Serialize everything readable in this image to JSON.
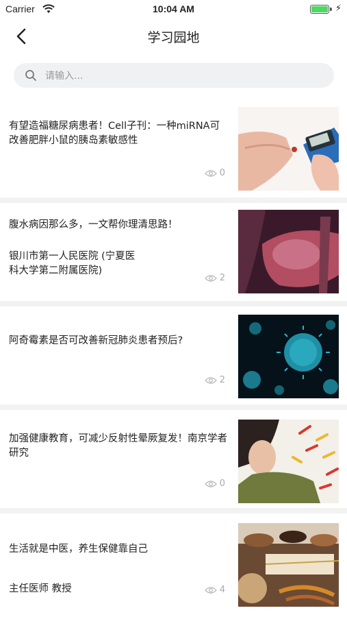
{
  "status_bar": {
    "carrier": "Carrier",
    "time": "10:04 AM",
    "battery_level": 1.0
  },
  "nav": {
    "title": "学习园地"
  },
  "search": {
    "placeholder": "请输入..."
  },
  "articles": [
    {
      "title": "有望造福糖尿病患者！Cell子刊：一种miRNA可改善肥胖小鼠的胰岛素敏感性",
      "subtitle": "",
      "views": "0",
      "image": "glucose-meter-photo"
    },
    {
      "title": "腹水病因那么多，一文帮你理清思路！",
      "subtitle": "银川市第一人民医院 (宁夏医科大学第二附属医院)",
      "views": "2",
      "image": "liver-illustration"
    },
    {
      "title": "阿奇霉素是否可改善新冠肺炎患者预后?",
      "subtitle": "",
      "views": "2",
      "image": "virus-illustration"
    },
    {
      "title": "加强健康教育，可减少反射性晕厥复发！南京学者研究",
      "subtitle": "",
      "views": "0",
      "image": "woman-lying-photo"
    },
    {
      "title": "生活就是中医，养生保健靠自己",
      "subtitle": "主任医师 教授",
      "views": "4",
      "image": "herbal-medicine-photo"
    }
  ]
}
